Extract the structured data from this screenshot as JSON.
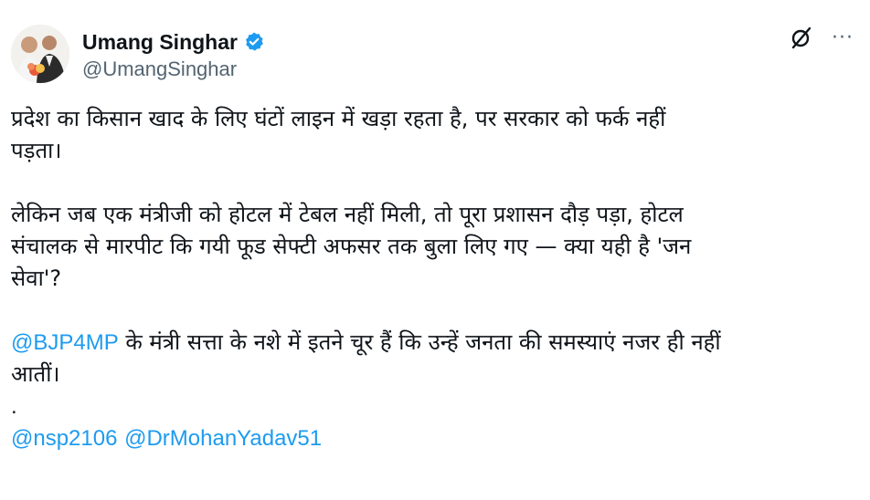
{
  "author": {
    "name": "Umang Singhar",
    "handle": "@UmangSinghar",
    "verified_icon": "verified-badge-icon",
    "verified_color": "#1d9bf0"
  },
  "actions": {
    "grok_icon": "grok-icon",
    "more_icon": "more-options-icon",
    "more_label": "···"
  },
  "tweet": {
    "para1_line1": "प्रदेश का किसान खाद के लिए घंटों लाइन में खड़ा रहता है, पर सरकार को फर्क नहीं",
    "para1_line2": "पड़ता।",
    "para2_line1": "लेकिन जब एक मंत्रीजी को होटल में टेबल नहीं मिली, तो पूरा प्रशासन दौड़ पड़ा, होटल",
    "para2_line2": "संचालक से मारपीट कि गयी फूड सेफ्टी अफसर तक बुला लिए गए — क्या यही है 'जन",
    "para2_line3": "सेवा'?",
    "para3_mention": "@BJP4MP",
    "para3_line1_rest": " के मंत्री सत्ता के नशे में इतने चूर हैं कि उन्हें जनता की समस्याएं नजर ही नहीं",
    "para3_line2": "आतीं।",
    "dot": ".",
    "mention_nsp": "@nsp2106",
    "mention_cm": "@DrMohanYadav51"
  },
  "colors": {
    "text": "#0f1419",
    "secondary": "#536471",
    "link": "#1d9bf0"
  }
}
